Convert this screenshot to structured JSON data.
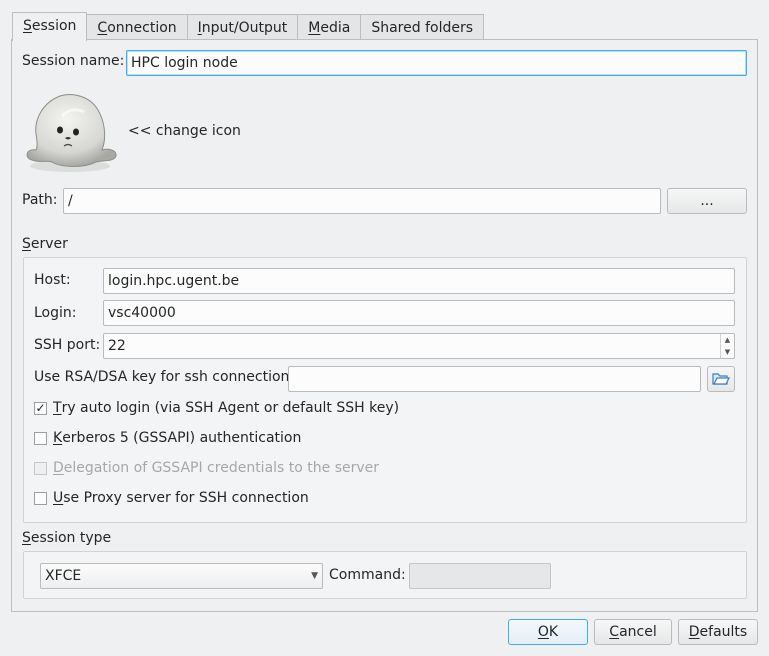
{
  "tabs": [
    {
      "label": "Session",
      "underline": "S",
      "rest": "ession"
    },
    {
      "label": "Connection",
      "underline": "C",
      "rest": "onnection"
    },
    {
      "label": "Input/Output",
      "underline": "I",
      "rest": "nput/Output"
    },
    {
      "label": "Media",
      "underline": "M",
      "rest": "edia"
    },
    {
      "label": "Shared folders",
      "underline": "",
      "rest": "Shared folders"
    }
  ],
  "session": {
    "name_label": "Session name:",
    "name_value": "HPC login node",
    "icon_name": "seal-icon",
    "change_icon_label": "<< change icon",
    "path_label": "Path:",
    "path_value": "/",
    "browse_label": "..."
  },
  "server": {
    "title_u": "S",
    "title_rest": "erver",
    "host_label": "Host:",
    "host_value": "login.hpc.ugent.be",
    "login_label": "Login:",
    "login_value": "vsc40000",
    "ssh_port_label": "SSH port:",
    "ssh_port_value": "22",
    "rsa_label": "Use RSA/DSA key for ssh connection:",
    "rsa_value": "",
    "folder_icon": "folder-open-icon",
    "auto_login_u": "T",
    "auto_login_rest": "ry auto login (via SSH Agent or default SSH key)",
    "auto_login_checked": true,
    "kerberos_u": "K",
    "kerberos_rest": "erberos 5 (GSSAPI) authentication",
    "kerberos_checked": false,
    "delegation_u": "D",
    "delegation_rest": "elegation of GSSAPI credentials to the server",
    "delegation_checked": false,
    "proxy_u": "U",
    "proxy_rest": "se Proxy server for SSH connection",
    "proxy_checked": false
  },
  "session_type": {
    "title_u": "S",
    "title_rest": "ession type",
    "selected": "XFCE",
    "command_label": "Command:",
    "command_value": ""
  },
  "buttons": {
    "ok_u": "O",
    "ok_rest": "K",
    "cancel_u": "C",
    "cancel_rest": "ancel",
    "defaults_u": "D",
    "defaults_rest": "efaults"
  },
  "colors": {
    "accent": "#3daee9",
    "background": "#eff0f1"
  }
}
